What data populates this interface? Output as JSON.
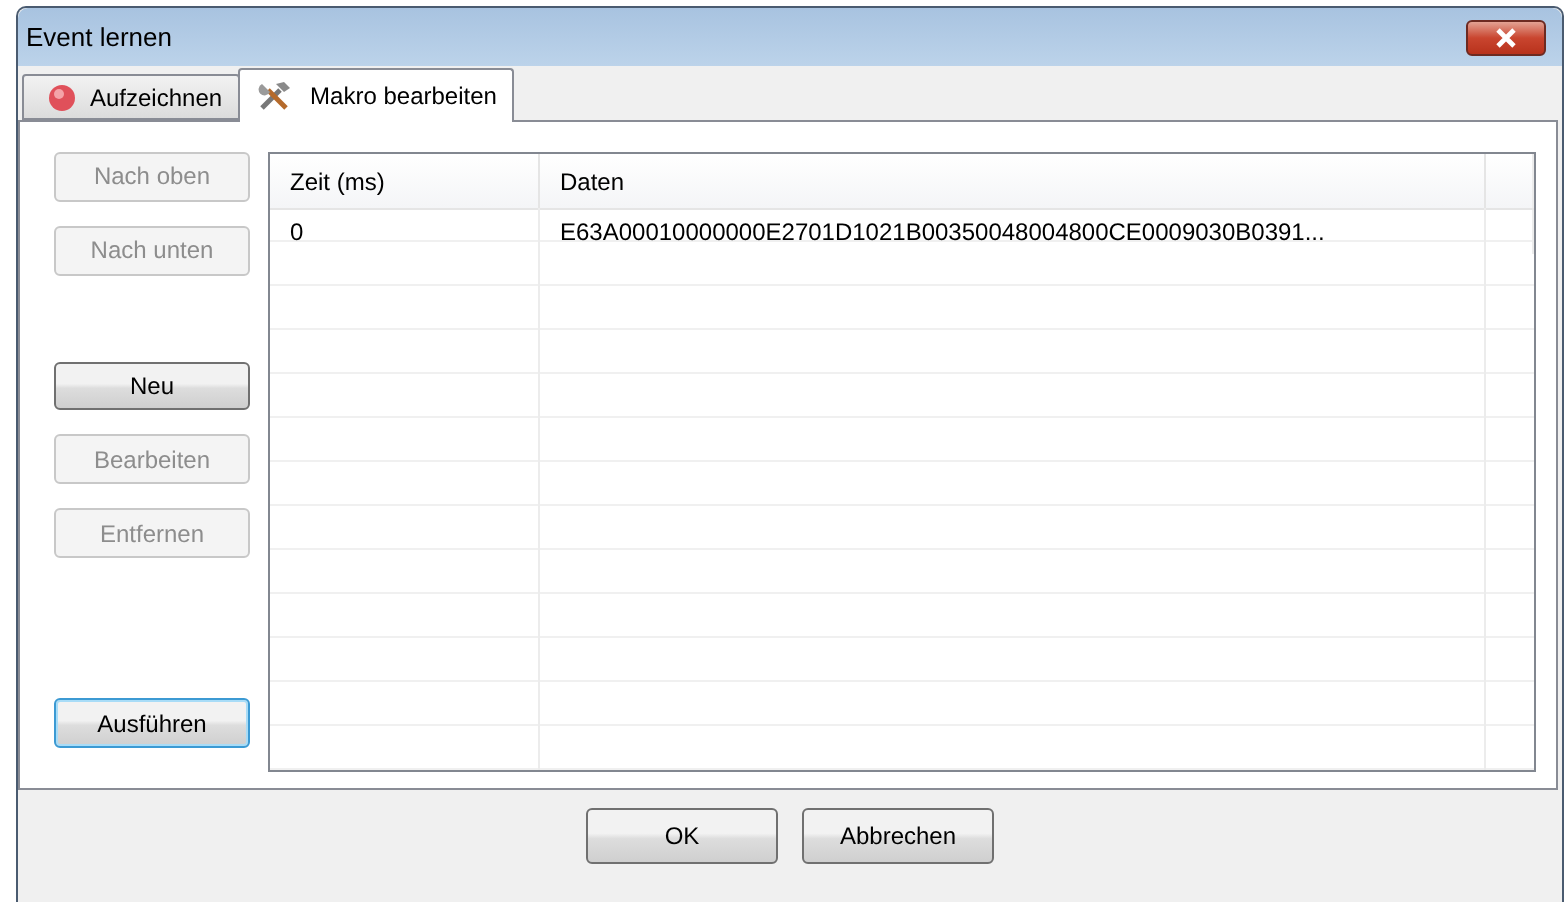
{
  "window": {
    "title": "Event lernen"
  },
  "tabs": [
    {
      "label": "Aufzeichnen",
      "selected": false
    },
    {
      "label": "Makro bearbeiten",
      "selected": true
    }
  ],
  "side_buttons": [
    {
      "label": "Nach oben",
      "disabled": true,
      "focused": false
    },
    {
      "label": "Nach unten",
      "disabled": true,
      "focused": false
    },
    {
      "label": "Neu",
      "disabled": false,
      "focused": false
    },
    {
      "label": "Bearbeiten",
      "disabled": true,
      "focused": false
    },
    {
      "label": "Entfernen",
      "disabled": true,
      "focused": false
    },
    {
      "label": "Ausführen",
      "disabled": false,
      "focused": true
    }
  ],
  "table": {
    "columns": [
      "Zeit (ms)",
      "Daten"
    ],
    "rows": [
      {
        "cells": [
          "0",
          "E63A00010000000E2701D1021B00350048004800CE0009030B0391..."
        ]
      }
    ]
  },
  "dialog_buttons": [
    {
      "label": "OK"
    },
    {
      "label": "Abbrechen"
    }
  ]
}
